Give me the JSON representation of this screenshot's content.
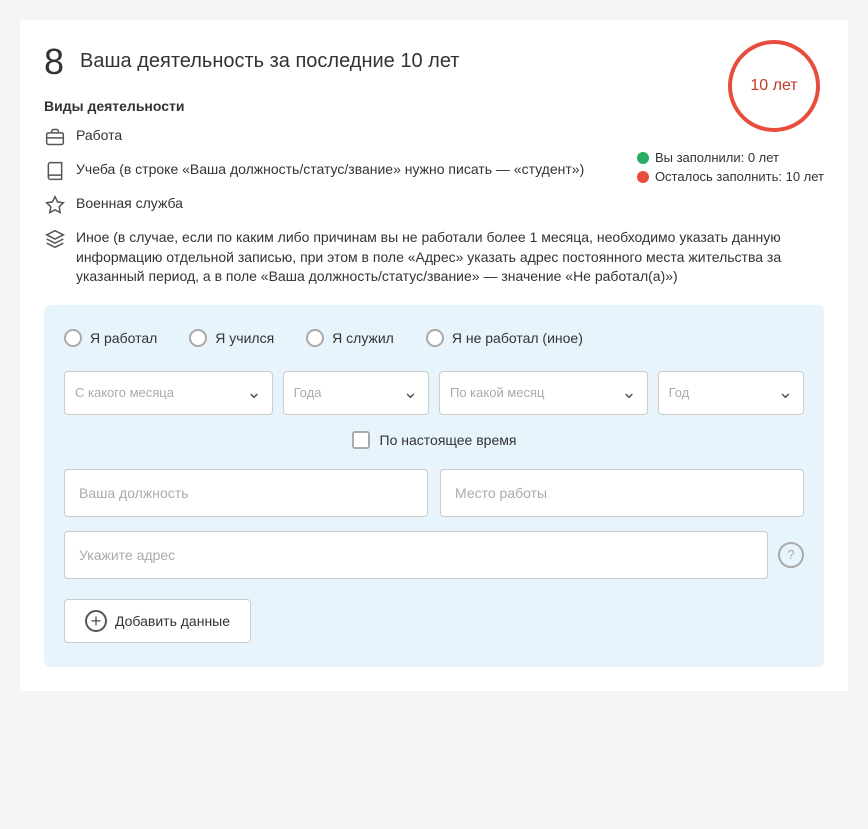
{
  "section": {
    "number": "8",
    "title": "Ваша деятельность за последние 10 лет",
    "circle_label": "10 лет"
  },
  "activity_types": {
    "title": "Виды деятельности",
    "items": [
      {
        "id": "work",
        "icon": "briefcase",
        "text": "Работа"
      },
      {
        "id": "study",
        "icon": "book",
        "text": "Учеба (в строке «Ваша должность/статус/звание» нужно писать — «студент»)"
      },
      {
        "id": "military",
        "icon": "star",
        "text": "Военная служба"
      },
      {
        "id": "other",
        "icon": "layers",
        "text": "Иное (в случае, если по каким либо причинам вы не работали более 1 месяца, необходимо указать данную информацию отдельной записью, при этом в поле «Адрес» указать адрес постоянного места жительства за указанный период, а в поле «Ваша должность/статус/звание» — значение «Не работал(а)»)"
      }
    ]
  },
  "legend": {
    "filled": "Вы заполнили: 0 лет",
    "remaining": "Осталось заполнить: 10 лет"
  },
  "form": {
    "radio_options": [
      {
        "id": "worked",
        "label": "Я работал"
      },
      {
        "id": "studied",
        "label": "Я учился"
      },
      {
        "id": "served",
        "label": "Я служил"
      },
      {
        "id": "not_worked",
        "label": "Я не работал (иное)"
      }
    ],
    "from_month_placeholder": "С какого месяца",
    "from_year_placeholder": "Года",
    "to_month_placeholder": "По какой месяц",
    "to_year_placeholder": "Год",
    "present_label": "По настоящее время",
    "position_placeholder": "Ваша должность",
    "workplace_placeholder": "Место работы",
    "address_placeholder": "Укажите адрес",
    "add_label": "Добавить данные"
  }
}
